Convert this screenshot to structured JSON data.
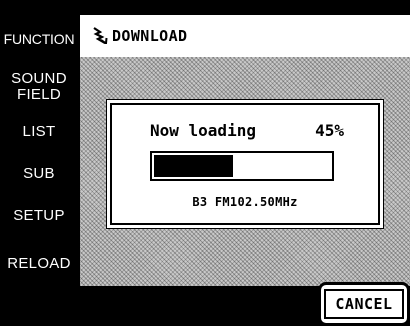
{
  "sidebar": {
    "items": [
      {
        "label": "FUNCTION"
      },
      {
        "label_line1": "SOUND",
        "label_line2": "FIELD"
      },
      {
        "label": "LIST"
      },
      {
        "label": "SUB"
      },
      {
        "label": "SETUP"
      },
      {
        "label": "RELOAD"
      }
    ]
  },
  "header": {
    "icon": "download-icon",
    "title": "DOWNLOAD"
  },
  "dialog": {
    "loading_text": "Now loading",
    "percent_text": "45%",
    "progress": 0.45,
    "station_text": "B3 FM102.50MHz"
  },
  "cancel": {
    "label": "CANCEL"
  }
}
